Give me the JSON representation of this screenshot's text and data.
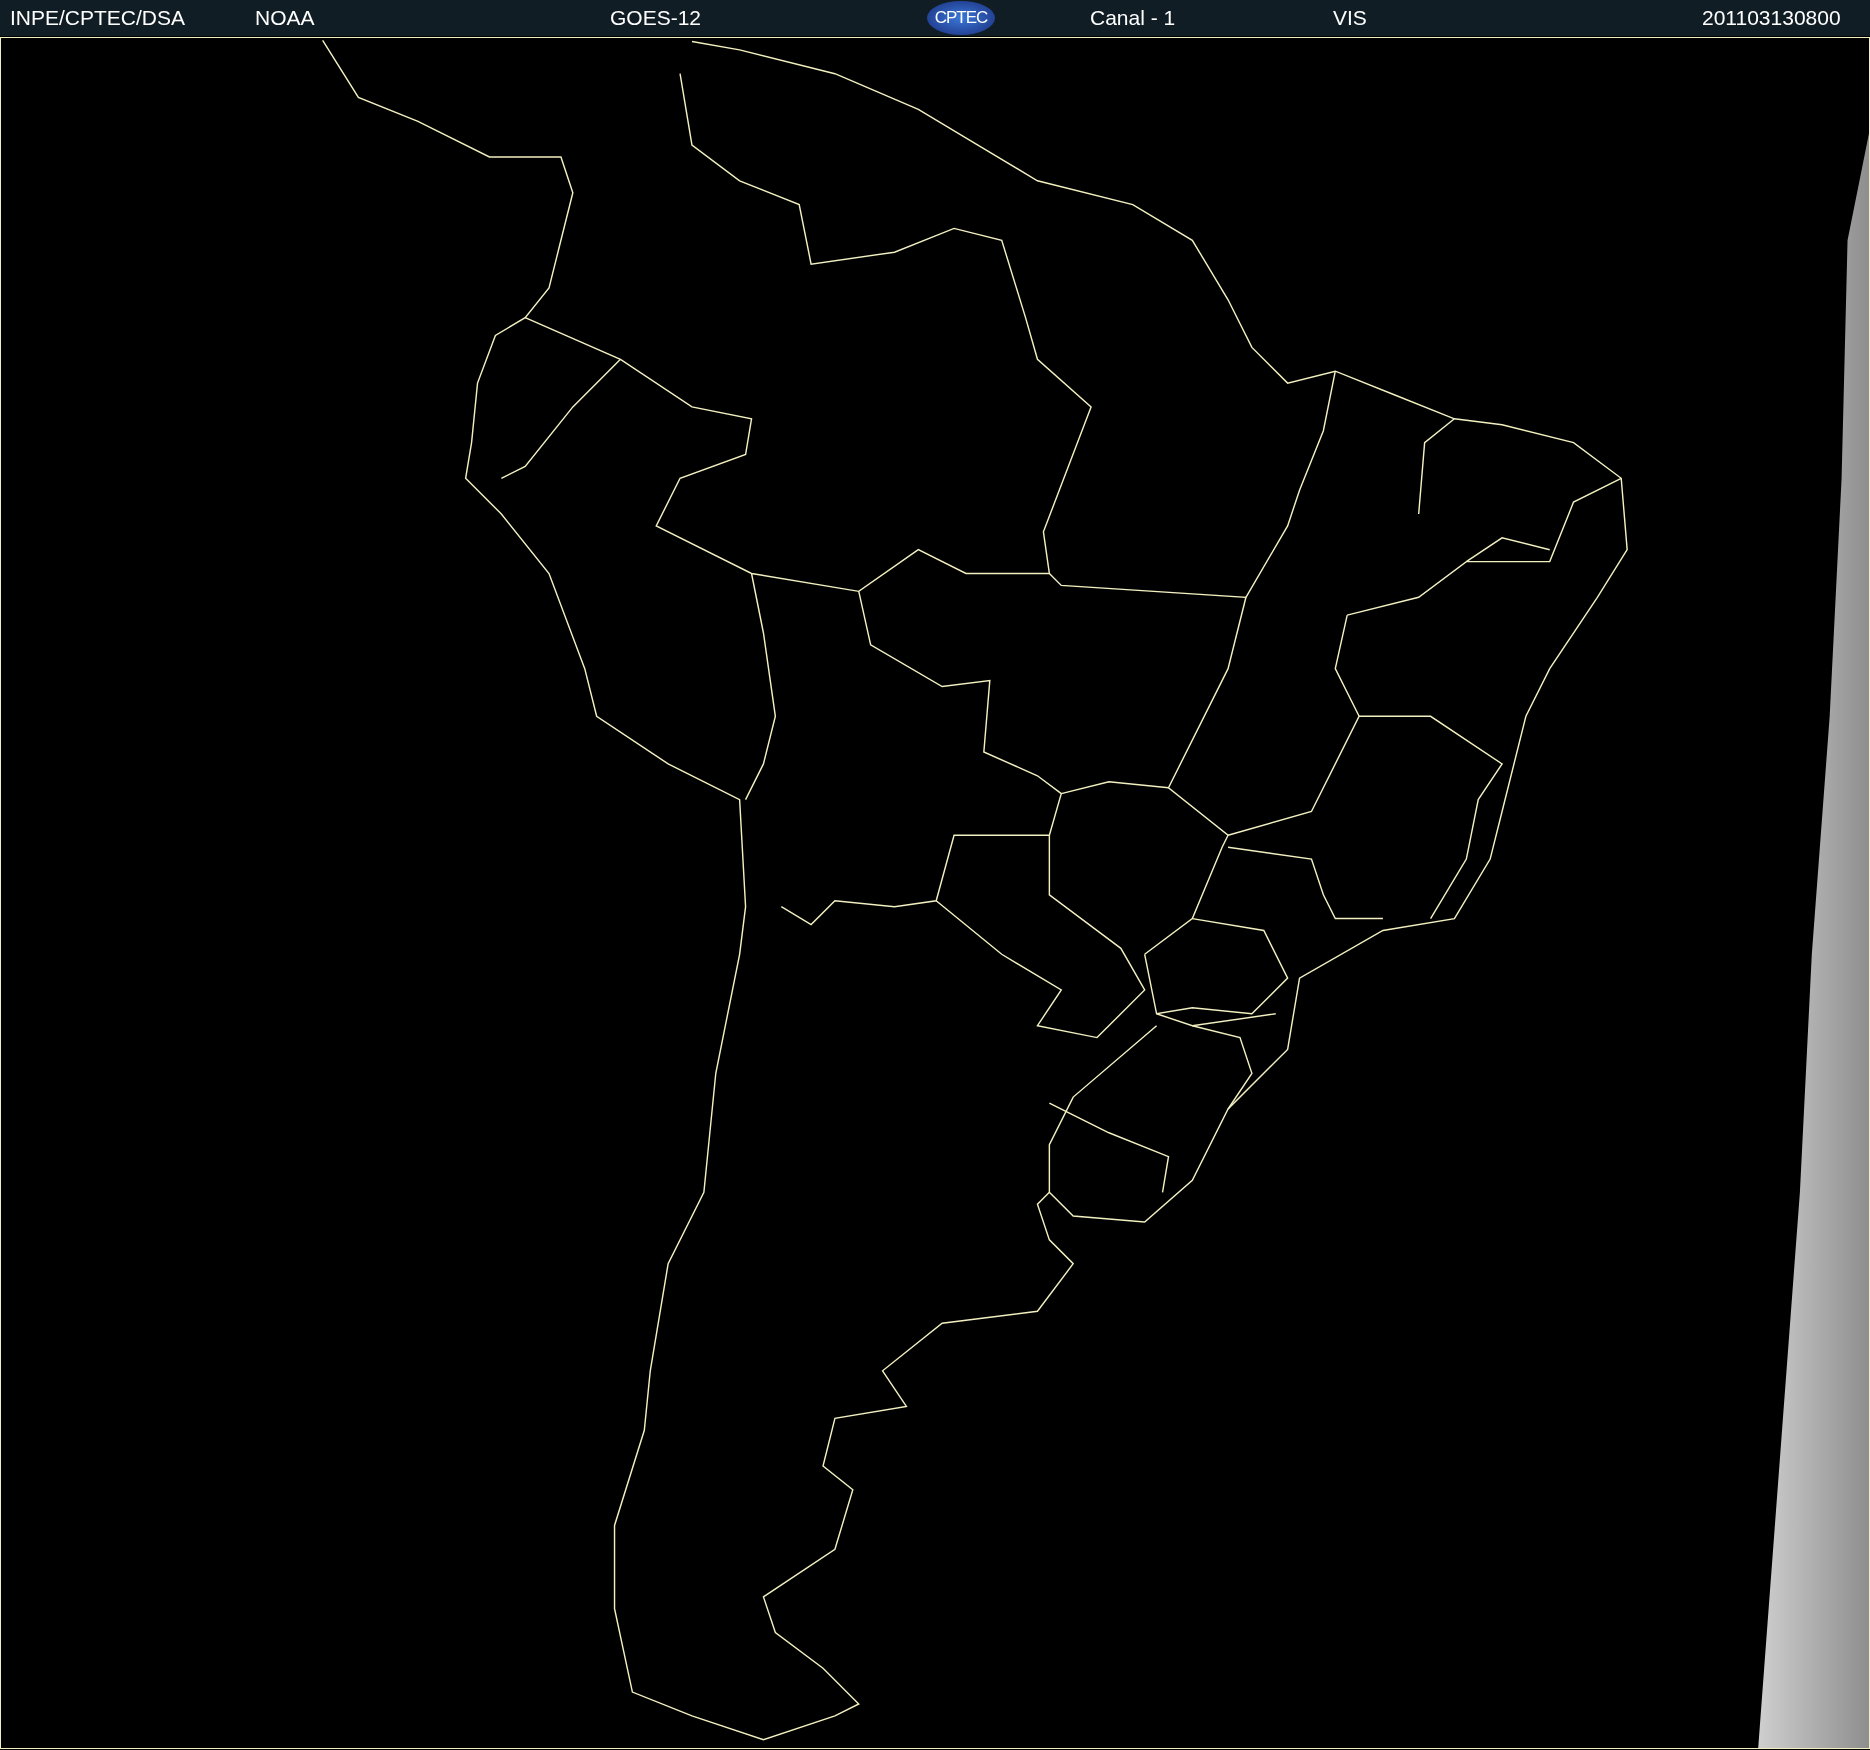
{
  "header": {
    "items": [
      {
        "kind": "text",
        "text": "INPE/CPTEC/DSA"
      },
      {
        "kind": "text",
        "text": "NOAA"
      },
      {
        "kind": "text",
        "text": "GOES-12"
      },
      {
        "kind": "logo",
        "text": "CPTEC"
      },
      {
        "kind": "text",
        "text": "Canal - 1"
      },
      {
        "kind": "text",
        "text": "VIS"
      },
      {
        "kind": "text",
        "text": "201103130800"
      }
    ]
  }
}
